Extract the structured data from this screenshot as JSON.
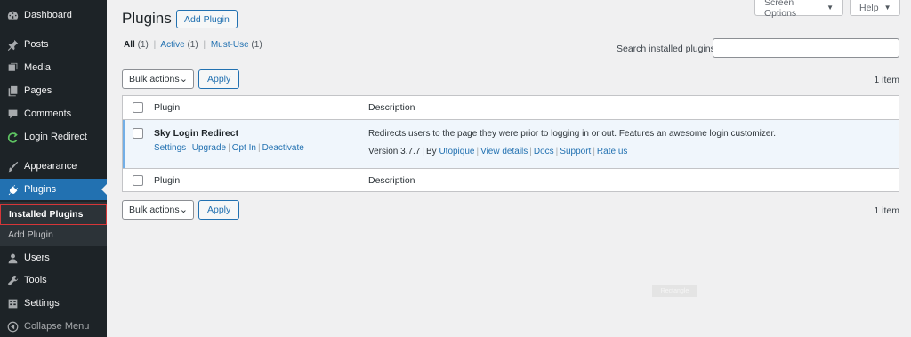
{
  "sidebar": {
    "items": [
      {
        "label": "Dashboard",
        "icon": "dashboard-icon"
      },
      {
        "label": "Posts",
        "icon": "pushpin-icon"
      },
      {
        "label": "Media",
        "icon": "media-icon"
      },
      {
        "label": "Pages",
        "icon": "pages-icon"
      },
      {
        "label": "Comments",
        "icon": "comment-icon"
      },
      {
        "label": "Login Redirect",
        "icon": "redirect-icon"
      },
      {
        "label": "Appearance",
        "icon": "paintbrush-icon"
      },
      {
        "label": "Plugins",
        "icon": "plugin-icon"
      },
      {
        "label": "Users",
        "icon": "user-icon"
      },
      {
        "label": "Tools",
        "icon": "wrench-icon"
      },
      {
        "label": "Settings",
        "icon": "settings-icon"
      },
      {
        "label": "Collapse Menu",
        "icon": "collapse-icon"
      }
    ],
    "submenu": [
      "Installed Plugins",
      "Add Plugin"
    ],
    "active_item": "Plugins",
    "active_color": "#2271b1"
  },
  "header": {
    "title": "Plugins",
    "add_button": "Add Plugin",
    "screen_options": "Screen Options",
    "help": "Help"
  },
  "filters": {
    "all": "All",
    "all_count": "(1)",
    "active": "Active",
    "active_count": "(1)",
    "mustuse": "Must-Use",
    "mustuse_count": "(1)"
  },
  "search": {
    "label": "Search installed plugins",
    "value": ""
  },
  "bulk": {
    "select": "Bulk actions",
    "apply": "Apply",
    "items_count": "1 item"
  },
  "table": {
    "col_plugin": "Plugin",
    "col_description": "Description",
    "plugin": {
      "name": "Sky Login Redirect",
      "actions": [
        "Settings",
        "Upgrade",
        "Opt In",
        "Deactivate"
      ],
      "description": "Redirects users to the page they were prior to logging in or out. Features an awesome login customizer.",
      "version": "Version 3.7.7",
      "by": "By",
      "author": "Utopique",
      "links": [
        "View details",
        "Docs",
        "Support",
        "Rate us"
      ]
    }
  },
  "watermark": "Rectangle"
}
